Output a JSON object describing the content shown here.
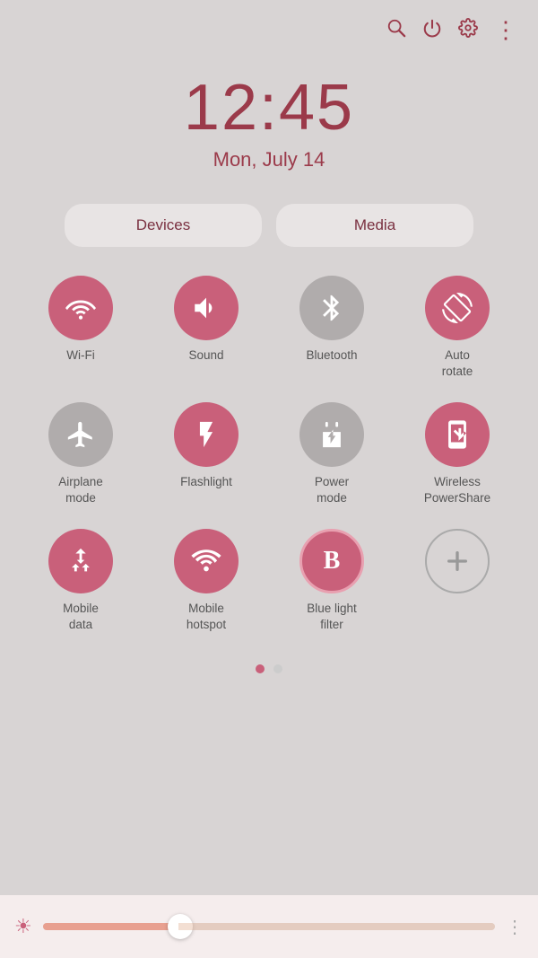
{
  "topbar": {
    "icons": [
      "search",
      "power",
      "settings",
      "more"
    ]
  },
  "clock": {
    "time": "12:45",
    "date": "Mon, July 14"
  },
  "tabs": [
    {
      "id": "devices",
      "label": "Devices"
    },
    {
      "id": "media",
      "label": "Media"
    }
  ],
  "quicksettings": [
    {
      "id": "wifi",
      "label": "Wi-Fi",
      "state": "active",
      "icon": "wifi"
    },
    {
      "id": "sound",
      "label": "Sound",
      "state": "active",
      "icon": "sound"
    },
    {
      "id": "bluetooth",
      "label": "Bluetooth",
      "state": "inactive",
      "icon": "bluetooth"
    },
    {
      "id": "autorotate",
      "label": "Auto\nrotate",
      "state": "active",
      "icon": "autorotate"
    },
    {
      "id": "airplane",
      "label": "Airplane\nmode",
      "state": "inactive",
      "icon": "airplane"
    },
    {
      "id": "flashlight",
      "label": "Flashlight",
      "state": "active",
      "icon": "flashlight"
    },
    {
      "id": "powermode",
      "label": "Power\nmode",
      "state": "inactive",
      "icon": "powermode"
    },
    {
      "id": "wireless",
      "label": "Wireless\nPowerShare",
      "state": "active",
      "icon": "wireless"
    },
    {
      "id": "mobiledata",
      "label": "Mobile\ndata",
      "state": "active",
      "icon": "mobiledata"
    },
    {
      "id": "hotspot",
      "label": "Mobile\nhotspot",
      "state": "active",
      "icon": "hotspot"
    },
    {
      "id": "bluelight",
      "label": "Blue light\nfilter",
      "state": "active",
      "icon": "bluelight"
    },
    {
      "id": "add",
      "label": "",
      "state": "add",
      "icon": "add"
    }
  ],
  "dots": [
    {
      "active": true
    },
    {
      "active": false
    }
  ],
  "brightness": {
    "icon": "☀",
    "value": 30
  }
}
